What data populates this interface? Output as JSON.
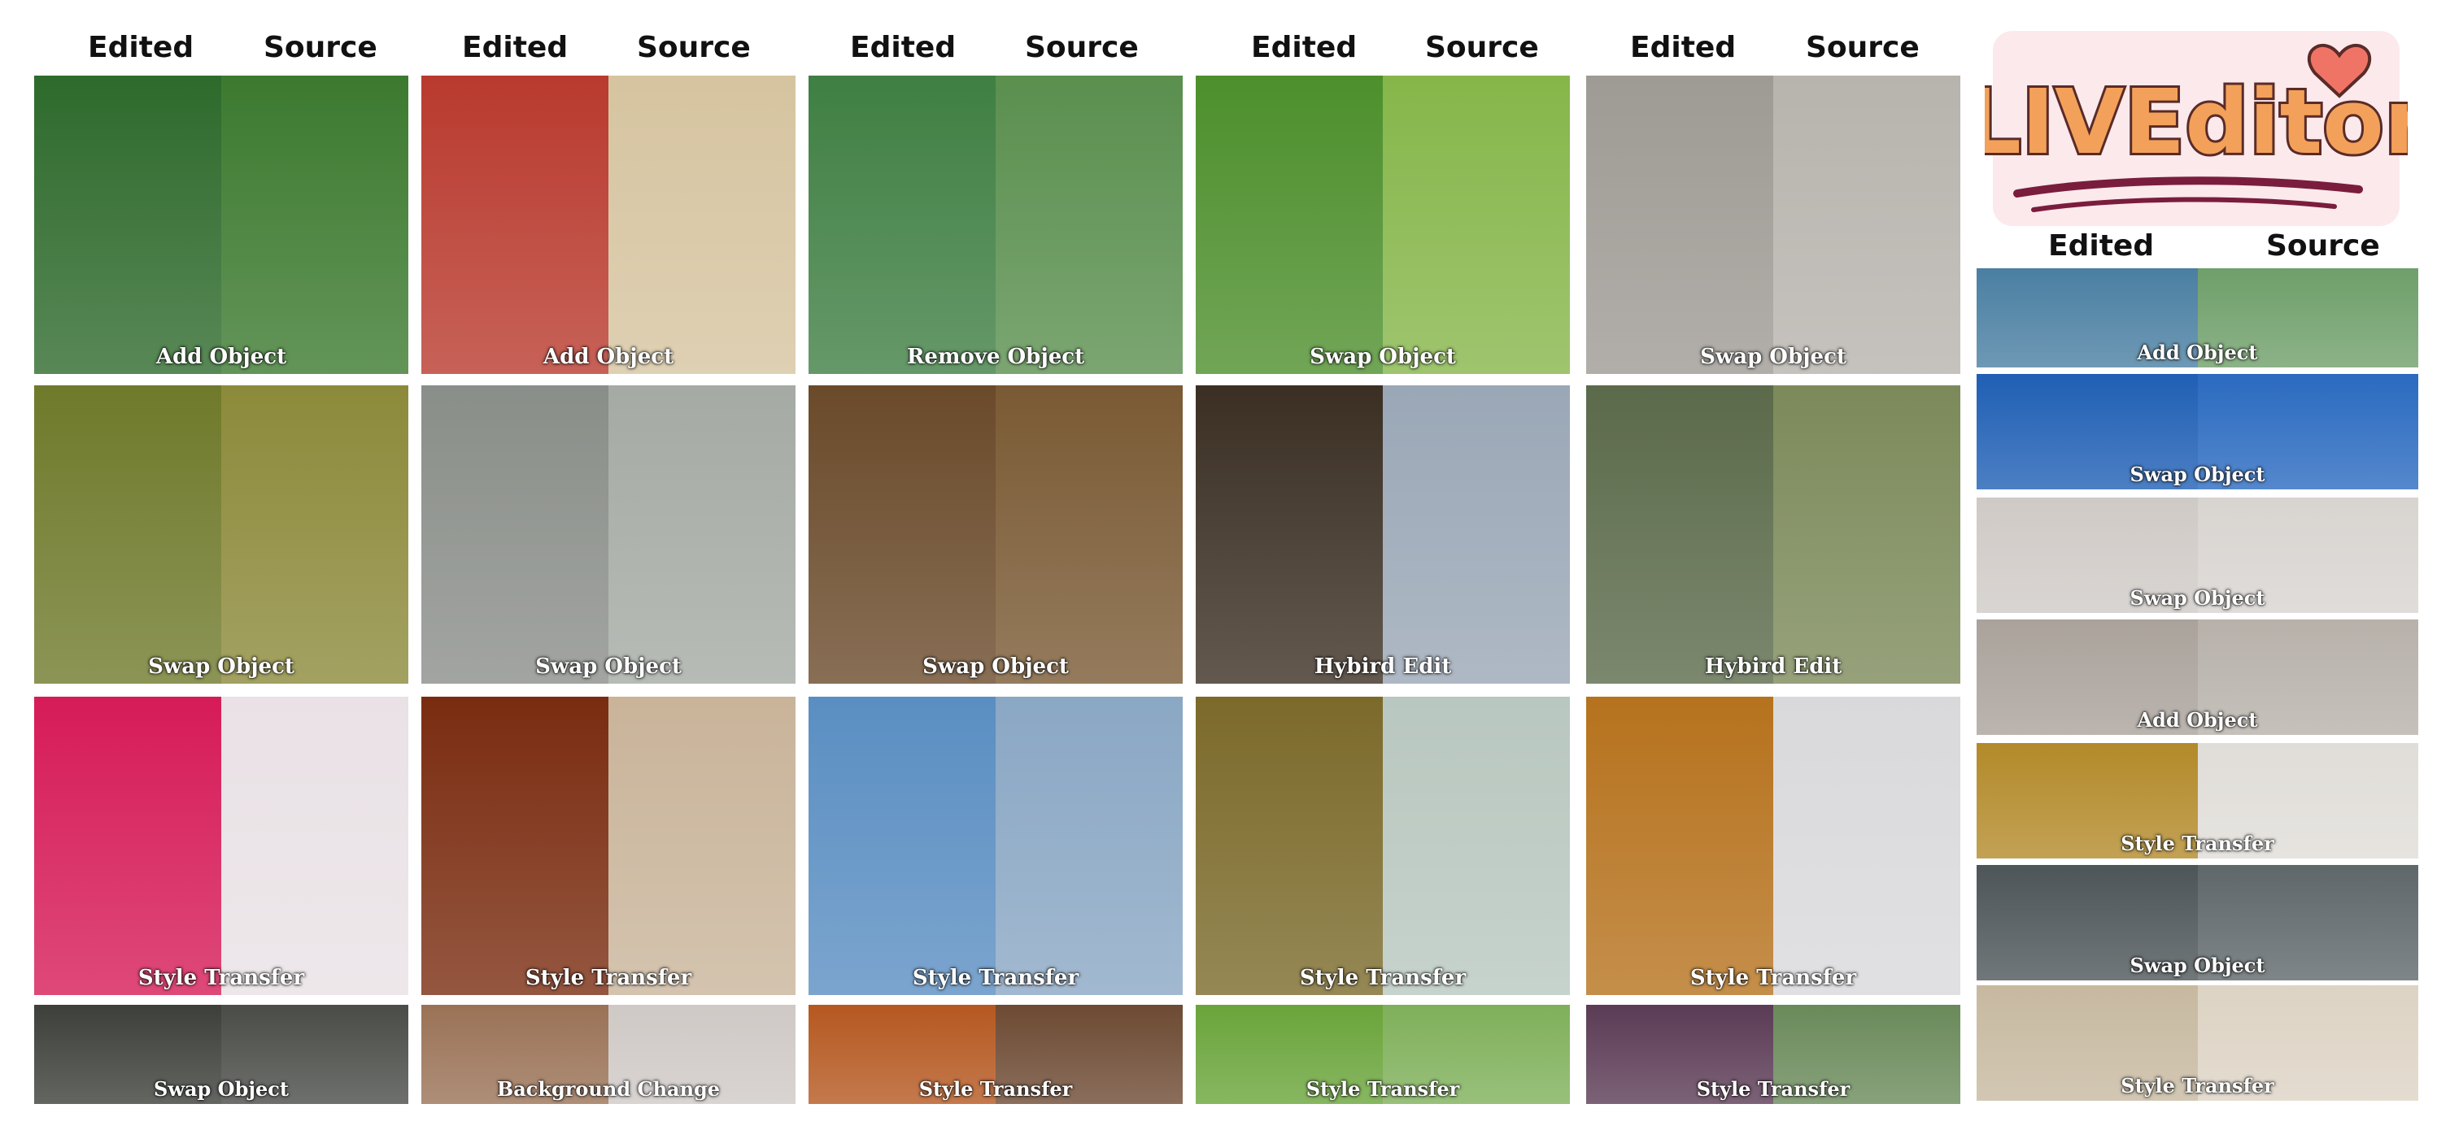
{
  "headers": {
    "edited": "Edited",
    "source": "Source"
  },
  "logo": {
    "text": "LIVEditor"
  },
  "panels": [
    {
      "caption": "Add Object",
      "colors": [
        "#2e6a2c",
        "#3c7a2f"
      ]
    },
    {
      "caption": "Add Object",
      "colors": [
        "#b93a2e",
        "#d6c4a0"
      ]
    },
    {
      "caption": "Remove Object",
      "colors": [
        "#3f7f43",
        "#5a8f4e"
      ]
    },
    {
      "caption": "Swap Object",
      "colors": [
        "#4d8f2c",
        "#86b64a"
      ]
    },
    {
      "caption": "Swap Object",
      "colors": [
        "#9e9a94",
        "#b7b3ad"
      ]
    },
    {
      "caption": "Swap Object",
      "colors": [
        "#6f7a2b",
        "#8c8a3a"
      ]
    },
    {
      "caption": "Swap Object",
      "colors": [
        "#8a8e89",
        "#a5aaa4"
      ]
    },
    {
      "caption": "Swap Object",
      "colors": [
        "#6a4a2a",
        "#7a5a34"
      ]
    },
    {
      "caption": "Hybird Edit",
      "colors": [
        "#3b2f23",
        "#9aa7b6"
      ]
    },
    {
      "caption": "Hybird Edit",
      "colors": [
        "#5b6a4a",
        "#7c8a5a"
      ]
    },
    {
      "caption": "Style Transfer",
      "colors": [
        "#d61b58",
        "#e9e1e5"
      ]
    },
    {
      "caption": "Style Transfer",
      "colors": [
        "#7a2c10",
        "#c9b49a"
      ]
    },
    {
      "caption": "Style Transfer",
      "colors": [
        "#5a8ec2",
        "#8aa7c4"
      ]
    },
    {
      "caption": "Style Transfer",
      "colors": [
        "#7b6a2a",
        "#b8c7bf"
      ]
    },
    {
      "caption": "Style Transfer",
      "colors": [
        "#b6721d",
        "#d9d9dc"
      ]
    },
    {
      "caption": "Swap Object",
      "colors": [
        "#3d3f3a",
        "#4a4c48"
      ]
    },
    {
      "caption": "Background Change",
      "colors": [
        "#9a7256",
        "#cfc9c6"
      ]
    },
    {
      "caption": "Style Transfer",
      "colors": [
        "#b55820",
        "#6d4a33"
      ]
    },
    {
      "caption": "Style Transfer",
      "colors": [
        "#6aa43a",
        "#7fb05a"
      ]
    },
    {
      "caption": "Style Transfer",
      "colors": [
        "#5b3b55",
        "#6a8a5a"
      ]
    },
    {
      "caption": "Add Object",
      "colors": [
        "#4a7fa2",
        "#6f9f6a"
      ]
    },
    {
      "caption": "Swap Object",
      "colors": [
        "#1f5fb4",
        "#2a6ac0"
      ]
    },
    {
      "caption": "Swap Object",
      "colors": [
        "#cfcac6",
        "#d8d4d0"
      ]
    },
    {
      "caption": "Add Object",
      "colors": [
        "#aaa29b",
        "#b7b1aa"
      ]
    },
    {
      "caption": "Style Transfer",
      "colors": [
        "#b38a2a",
        "#e0ddd8"
      ]
    },
    {
      "caption": "Swap Object",
      "colors": [
        "#4d5558",
        "#5f676a"
      ]
    },
    {
      "caption": "Style Transfer",
      "colors": [
        "#c7b9a0",
        "#ddd3c4"
      ]
    }
  ]
}
